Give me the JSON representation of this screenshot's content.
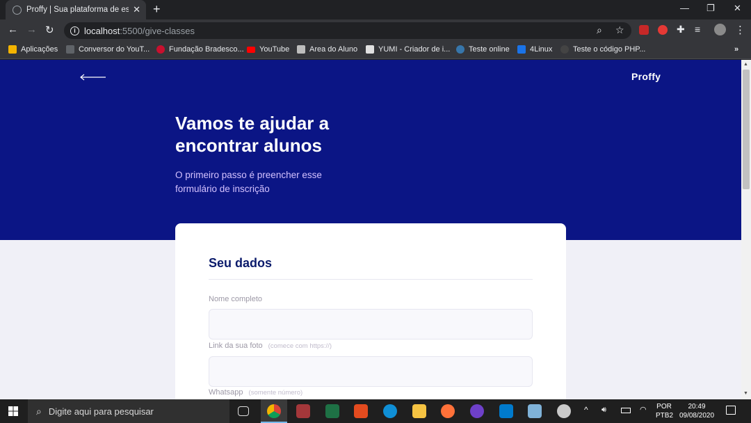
{
  "browser": {
    "tab_title": "Proffy | Sua plataforma de estudos",
    "url_host": "localhost",
    "url_path": ":5500/give-classes",
    "bookmarks": [
      {
        "label": "Aplicações",
        "color": "#f4b400"
      },
      {
        "label": "Conversor do YouT...",
        "color": "#5f6368"
      },
      {
        "label": "Fundação Bradesco...",
        "color": "#c8102e"
      },
      {
        "label": "YouTube",
        "color": "#ff0000"
      },
      {
        "label": "Area do Aluno",
        "color": "#bdbdbd"
      },
      {
        "label": "YUMI - Criador de i...",
        "color": "#e0e0e0"
      },
      {
        "label": "Teste online",
        "color": "#3776ab"
      },
      {
        "label": "4Linux",
        "color": "#1a73e8"
      },
      {
        "label": "Teste o código PHP...",
        "color": "#444444"
      }
    ]
  },
  "page": {
    "logo": "Proffy",
    "headline": "Vamos te ajudar a encontrar alunos",
    "lead": "O primeiro passo é preencher esse formulário de inscrição",
    "section_title": "Seu dados",
    "fields": [
      {
        "label": "Nome completo",
        "hint": ""
      },
      {
        "label": "Link da sua foto",
        "hint": "(comece com https://)"
      },
      {
        "label": "Whatsapp",
        "hint": "(somente número)"
      }
    ],
    "colors": {
      "hero": "#0b1585",
      "background": "#f0f0f7",
      "section_title": "#0b1b6b"
    }
  },
  "taskbar": {
    "search_placeholder": "Digite aqui para pesquisar",
    "lang_1": "POR",
    "lang_2": "PTB2",
    "time": "20:49",
    "date": "09/08/2020"
  }
}
